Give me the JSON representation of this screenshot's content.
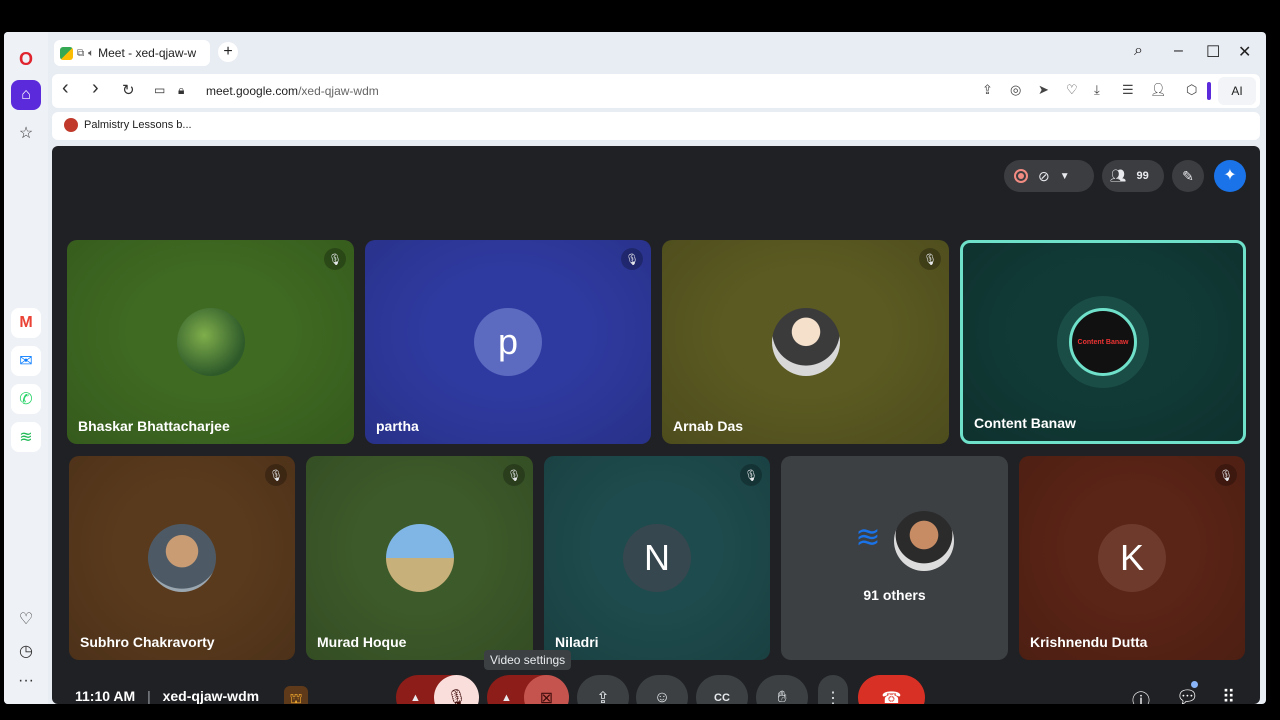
{
  "browser": {
    "tab": {
      "title": "Meet - xed-qjaw-w",
      "new_tab": "+"
    },
    "url": {
      "domain": "meet.google.com",
      "path": "/xed-qjaw-wdm"
    },
    "ai_label": "AI",
    "bookmark": "Palmistry Lessons b...",
    "window": {
      "minimize": "–",
      "maximize": "☐",
      "close": "✕",
      "search": "⌕"
    },
    "nav": {
      "back": "‹",
      "forward": "›",
      "reload": "↻"
    }
  },
  "sidebar": {
    "logo": "O",
    "home": "⌂",
    "star": "☆",
    "gmail": "M",
    "messenger": "✉",
    "whatsapp": "✆",
    "spotify": "≋",
    "heart": "♡",
    "history": "◷",
    "more": "···"
  },
  "meet": {
    "people_count": "99",
    "participants": [
      {
        "name": "Bhaskar Bhattacharjee",
        "bg": "#3f6a22"
      },
      {
        "name": "partha",
        "initial": "p",
        "bg": "#2f3aa0"
      },
      {
        "name": "Arnab Das",
        "bg": "#5b5a22"
      },
      {
        "name": "Content Banaw",
        "bg": "#113a36",
        "avatar_text": "Content Banaw"
      },
      {
        "name": "Subhro Chakravorty",
        "bg": "#5a3a1d"
      },
      {
        "name": "Murad Hoque",
        "bg": "#3d5a2a"
      },
      {
        "name": "Niladri",
        "initial": "N",
        "bg": "#1e4b4d"
      },
      {
        "name": "Krishnendu Dutta",
        "initial": "K",
        "bg": "#5a2416"
      }
    ],
    "others_label": "91 others",
    "tooltip": "Video settings",
    "time": "11:10 AM",
    "meeting_code": "xed-qjaw-wdm"
  },
  "colors": {
    "active_speaker": "#6fe0c9",
    "end_call": "#d93025",
    "muted_red": "#8c1d18"
  }
}
